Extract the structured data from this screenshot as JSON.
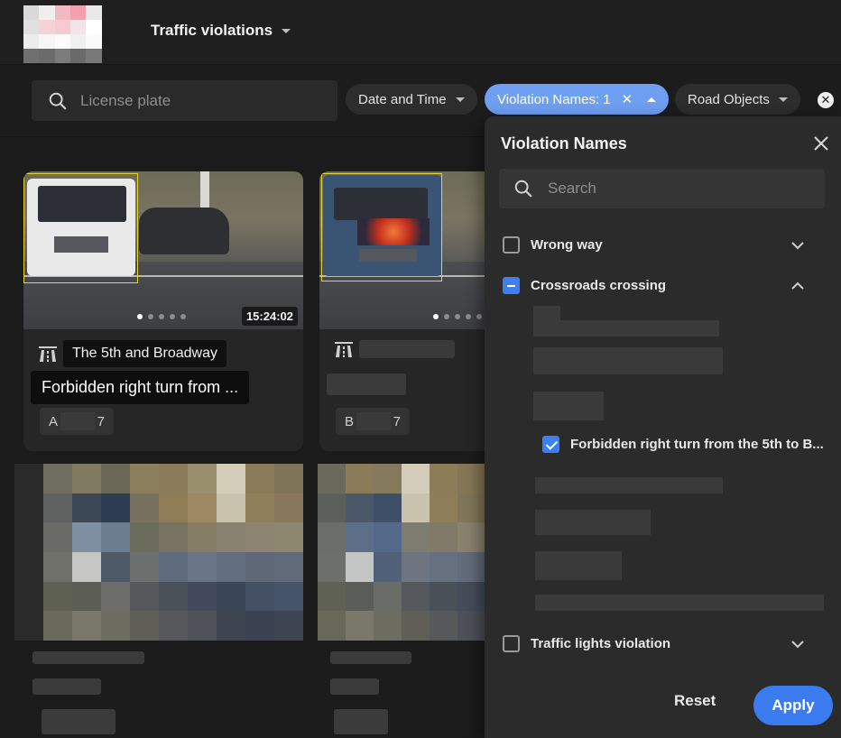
{
  "header": {
    "app_title": "Traffic violations"
  },
  "filters": {
    "search_placeholder": "License plate",
    "chips": [
      {
        "label": "Date and Time"
      },
      {
        "label": "Violation Names: 1"
      },
      {
        "label": "Road Objects"
      }
    ],
    "clear_icon": "clear-all-icon"
  },
  "cards": [
    {
      "time": "15:24:02",
      "location": "The 5th and Broadway",
      "violation": "Forbidden right turn from ...",
      "plate_start": "A",
      "plate_end": "7"
    },
    {
      "plate_start": "B",
      "plate_end": "7"
    }
  ],
  "panel": {
    "title": "Violation Names",
    "search_placeholder": "Search",
    "options": [
      {
        "label": "Wrong way",
        "state": "unchecked"
      },
      {
        "label": "Crossroads crossing",
        "state": "indeterminate"
      },
      {
        "label": "Traffic lights violation",
        "state": "unchecked"
      }
    ],
    "sub_option_checked": "Forbidden right turn from the 5th to B...",
    "reset_label": "Reset",
    "apply_label": "Apply"
  },
  "colors": {
    "accent": "#3a7cf0",
    "active_chip": "#6f9ff2",
    "bbox": "#e8d33a"
  }
}
